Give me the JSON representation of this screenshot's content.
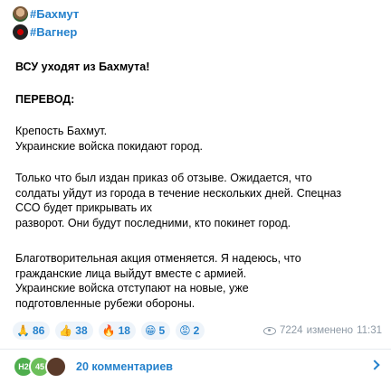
{
  "hashtags": [
    "#Бахмут",
    "#Вагнер"
  ],
  "post": {
    "title": "ВСУ уходят из Бахмута!",
    "translation_header": "ПЕРЕВОД:",
    "p1_l1": "Крепость Бахмут.",
    "p1_l2": "Украинские войска покидают город.",
    "p2_l1": "Только что был издан приказ об отзыве. Ожидается, что",
    "p2_l2": "солдаты уйдут из города в течение нескольких дней. Спецназ",
    "p2_l3": "ССО будет прикрывать их",
    "p2_l4": "разворот. Они будут последними, кто покинет город.",
    "p3_l1": "Благотворительная акция отменяется. Я надеюсь, что",
    "p3_l2": "гражданские лица выйдут вместе с армией.",
    "p3_l3": "Украинские войска отступают на новые, уже",
    "p3_l4": "подготовленные рубежи обороны."
  },
  "reactions": [
    {
      "icon": "pray-icon",
      "emoji": "🙏",
      "count": "86"
    },
    {
      "icon": "thumbs-up-icon",
      "emoji": "👍",
      "count": "38"
    },
    {
      "icon": "fire-icon",
      "emoji": "🔥",
      "count": "18"
    },
    {
      "icon": "grin-icon",
      "emoji": "😁",
      "count": "5"
    },
    {
      "icon": "angry-icon",
      "emoji": "😡",
      "count": "2"
    }
  ],
  "meta": {
    "views": "7224",
    "edited": "изменено",
    "time": "11:31"
  },
  "comments": {
    "avatar1": "H2",
    "avatar2": "45",
    "label": "20 комментариев"
  },
  "colors": {
    "link": "#2481cc",
    "meta": "#8d99a5",
    "reaction_bg": "#eef4fa"
  }
}
